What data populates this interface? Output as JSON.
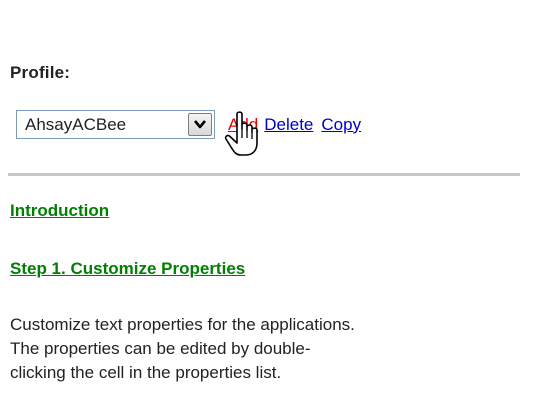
{
  "profile": {
    "label": "Profile:",
    "selected_value": "AhsayACBee",
    "add_label": "Add",
    "delete_label": "Delete",
    "copy_label": "Copy"
  },
  "sections": {
    "introduction": "Introduction",
    "step1": "Step 1. Customize Properties"
  },
  "description": {
    "line1": "Customize text properties for the applications.",
    "line2": "The properties can be edited by double-",
    "line3": "clicking the cell in the properties list."
  },
  "icons": {
    "dropdown": "chevron-down-icon",
    "cursor": "hand-pointer-cursor-icon"
  },
  "colors": {
    "add_link": "#ee0000",
    "link": "#0000cc",
    "section_link": "#008000",
    "divider": "#c8c8c8"
  }
}
